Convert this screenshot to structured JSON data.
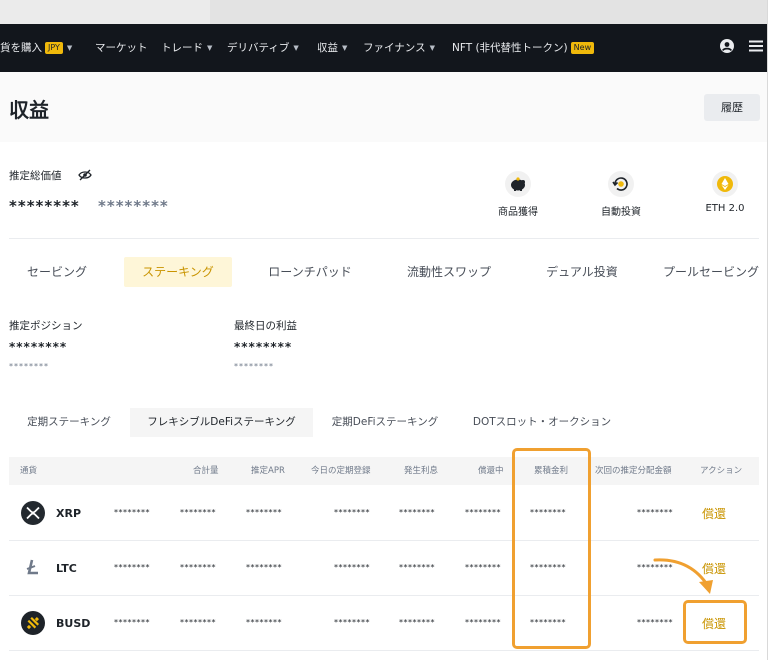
{
  "nav": {
    "buy_crypto": "貨を購入",
    "buy_badge": "JPY",
    "markets": "マーケット",
    "trade": "トレード",
    "derivatives": "デリバティブ",
    "earn": "収益",
    "finance": "ファイナンス",
    "nft": "NFT (非代替性トークン)",
    "nft_badge": "New",
    "right_icons": [
      "user-icon",
      "menu-icon"
    ]
  },
  "header": {
    "title": "収益",
    "history_button": "履歴"
  },
  "summary": {
    "total_label": "推定総価値",
    "total_value": "********",
    "total_value_alt": "********",
    "hide_icon": "eye-off-icon"
  },
  "quick_links": [
    {
      "label": "商品獲得",
      "icon": "piggy-bank-icon"
    },
    {
      "label": "自動投資",
      "icon": "auto-invest-icon"
    },
    {
      "label": "ETH 2.0",
      "icon": "ethereum-icon"
    }
  ],
  "tabs": [
    "セービング",
    "ステーキング",
    "ローンチパッド",
    "流動性スワップ",
    "デュアル投資",
    "プールセービング"
  ],
  "active_tab": "ステーキング",
  "stats": {
    "position_label": "推定ポジション",
    "position_value": "********",
    "position_sub": "********",
    "profit_label": "最終日の利益",
    "profit_value": "********",
    "profit_sub": "********"
  },
  "subtabs": [
    "定期ステーキング",
    "フレキシブルDeFiステーキング",
    "定期DeFiステーキング",
    "DOTスロット・オークション"
  ],
  "table": {
    "headers": [
      "通貨",
      "合計量",
      "推定APR",
      "今日の定期登録",
      "発生利息",
      "償還中",
      "累積金利",
      "次回の推定分配金額",
      "アクション"
    ],
    "rows": [
      {
        "coin": "XRP",
        "icon": "xrp-icon",
        "values": [
          "********",
          "********",
          "********",
          "********",
          "********",
          "********",
          "********",
          "********"
        ],
        "action": "償還"
      },
      {
        "coin": "LTC",
        "icon": "litecoin-icon",
        "values": [
          "********",
          "********",
          "********",
          "********",
          "********",
          "********",
          "********",
          "********"
        ],
        "action": "償還"
      },
      {
        "coin": "BUSD",
        "icon": "busd-icon",
        "values": [
          "********",
          "********",
          "********",
          "********",
          "********",
          "********",
          "********",
          "********"
        ],
        "action": "償還"
      }
    ]
  },
  "colors": {
    "brand": "#F0B90B",
    "highlight": "#F0A030",
    "nav_bg": "#12161C"
  }
}
